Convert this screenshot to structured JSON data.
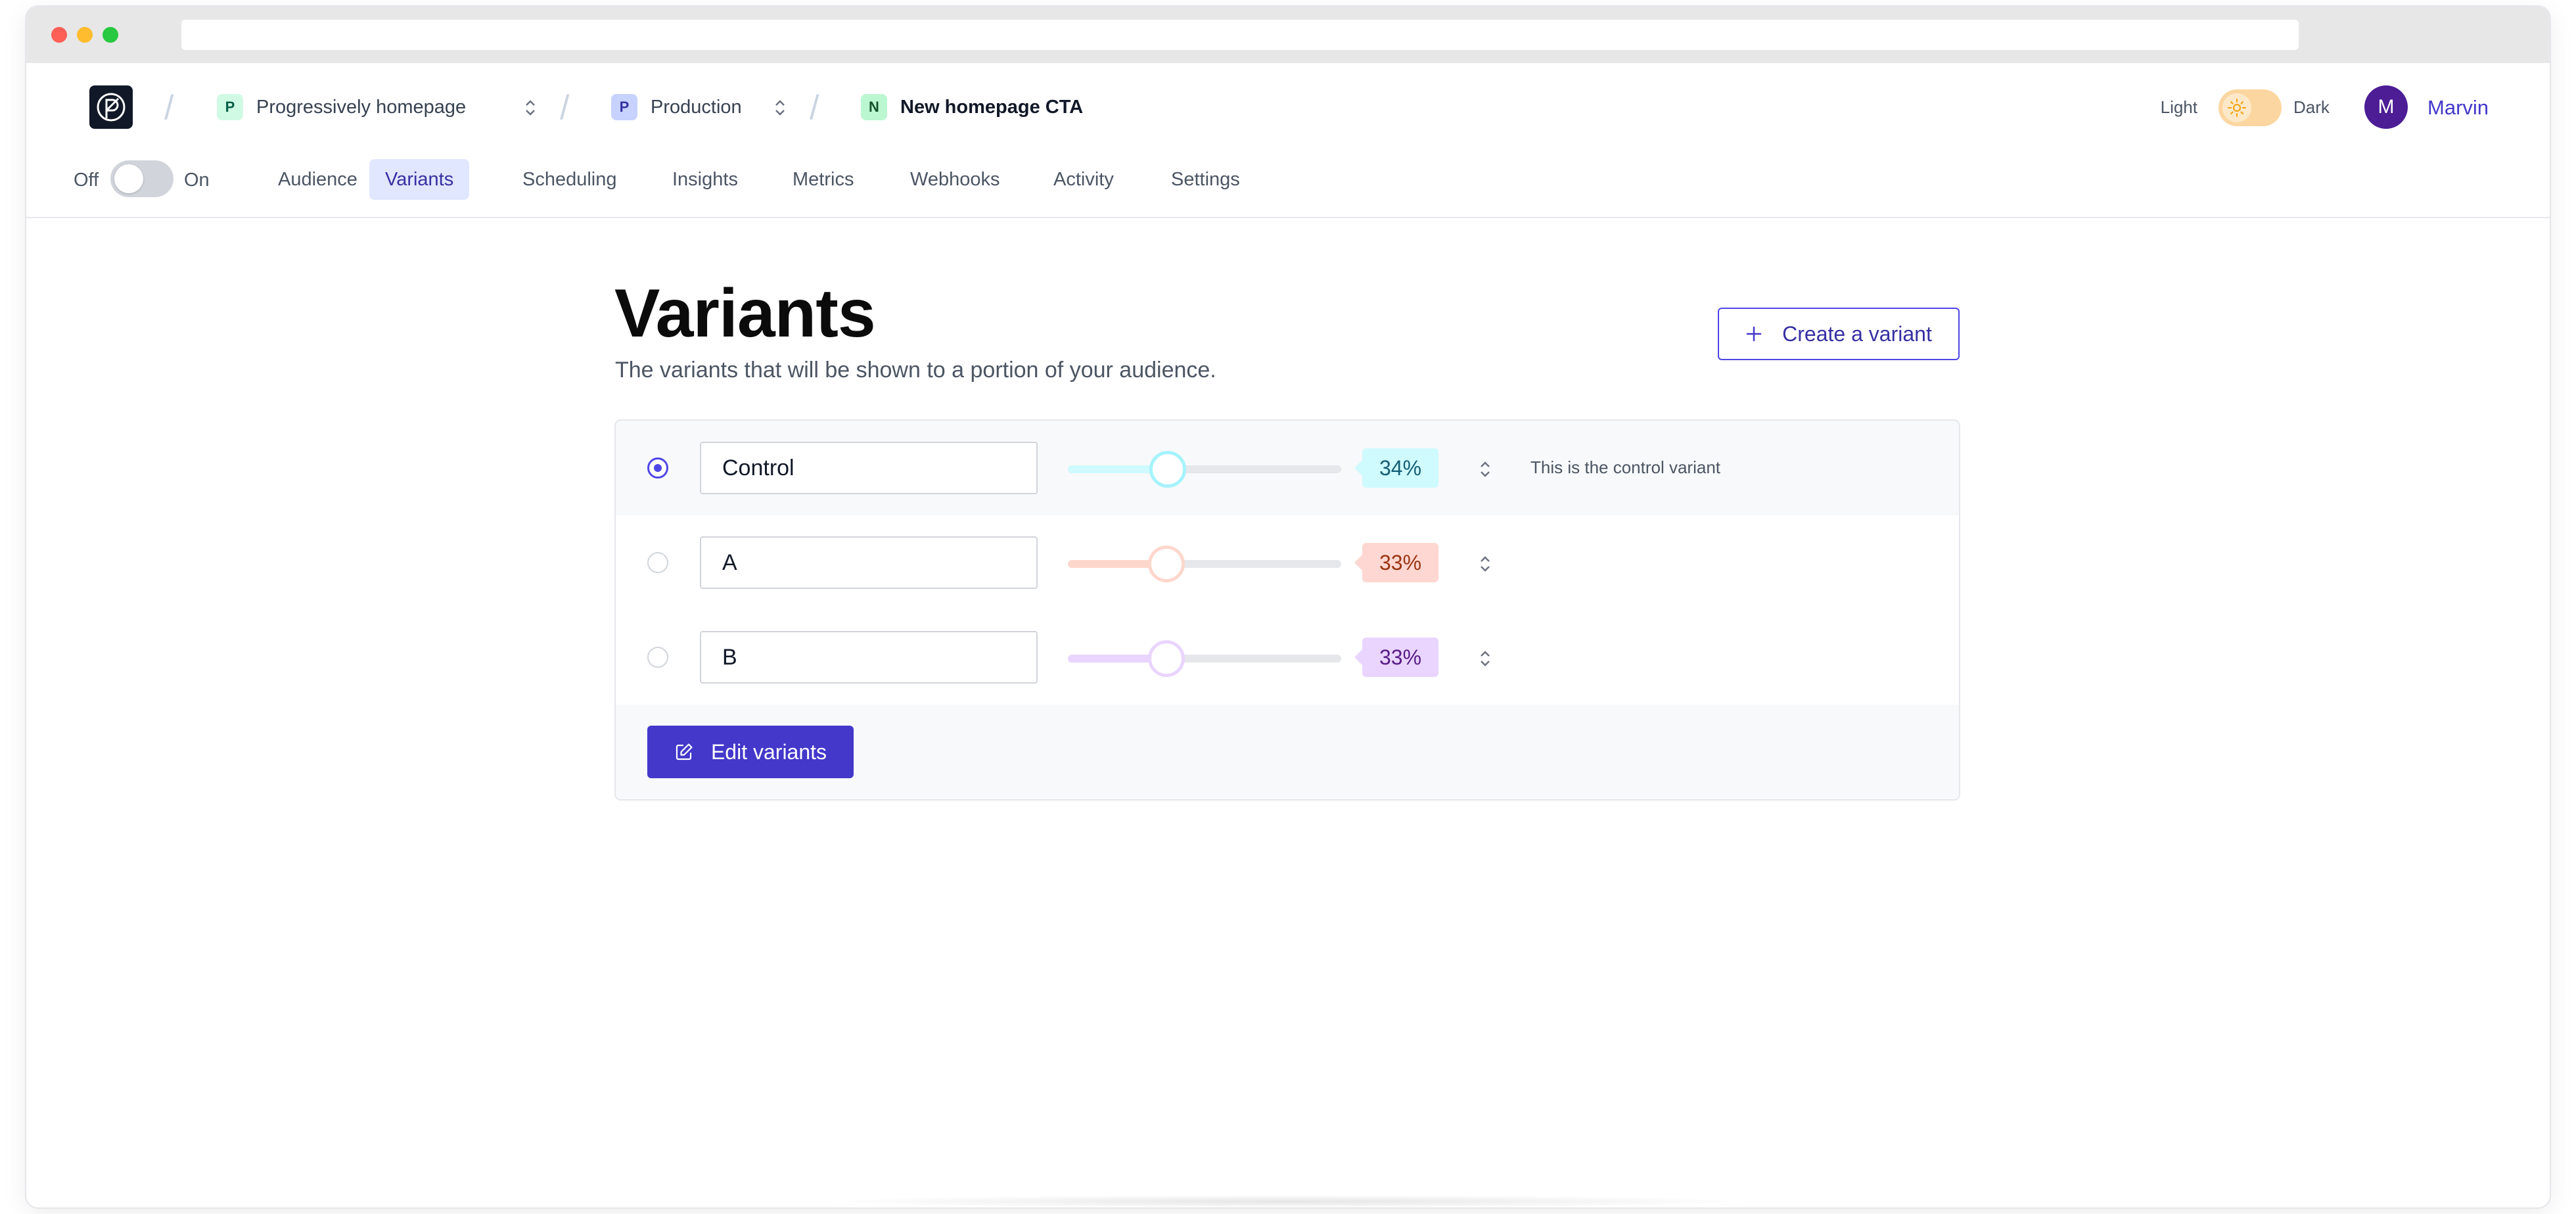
{
  "header": {
    "breadcrumbs": [
      {
        "badge": "P",
        "label": "Progressively homepage",
        "badge_bg": "#d1fae5",
        "badge_fg": "#065f46"
      },
      {
        "badge": "P",
        "label": "Production",
        "badge_bg": "#c7d2fe",
        "badge_fg": "#3730a3"
      },
      {
        "badge": "N",
        "label": "New homepage CTA",
        "badge_bg": "#bbf7d0",
        "badge_fg": "#14532d"
      }
    ],
    "theme": {
      "light_label": "Light",
      "dark_label": "Dark"
    },
    "user": {
      "initial": "M",
      "name": "Marvin"
    }
  },
  "nav": {
    "off_label": "Off",
    "on_label": "On",
    "tabs": [
      {
        "label": "Audience",
        "active": false
      },
      {
        "label": "Variants",
        "active": true
      },
      {
        "label": "Scheduling",
        "active": false
      },
      {
        "label": "Insights",
        "active": false
      },
      {
        "label": "Metrics",
        "active": false
      },
      {
        "label": "Webhooks",
        "active": false
      },
      {
        "label": "Activity",
        "active": false
      },
      {
        "label": "Settings",
        "active": false
      }
    ]
  },
  "main": {
    "title": "Variants",
    "subtitle": "The variants that will be shown to a portion of your audience.",
    "create_button": "Create a variant",
    "edit_button": "Edit variants",
    "variants": [
      {
        "name": "Control",
        "percent": 34,
        "percent_label": "34%",
        "is_control": true,
        "note": "This is the control variant",
        "color": "#22d3ee",
        "fill": "#cffafe",
        "badge_bg": "#cffafe",
        "badge_fg": "#155e75"
      },
      {
        "name": "A",
        "percent": 33,
        "percent_label": "33%",
        "is_control": false,
        "note": "",
        "color": "#fdba74",
        "fill": "#fed7cc",
        "badge_bg": "#fed7d2",
        "badge_fg": "#9a3412"
      },
      {
        "name": "B",
        "percent": 33,
        "percent_label": "33%",
        "is_control": false,
        "note": "",
        "color": "#d8b4fe",
        "fill": "#e9d5ff",
        "badge_bg": "#e9d5ff",
        "badge_fg": "#581c87"
      }
    ]
  },
  "colors": {
    "accent": "#4338ca",
    "active_tab_bg": "#e0e7ff"
  }
}
